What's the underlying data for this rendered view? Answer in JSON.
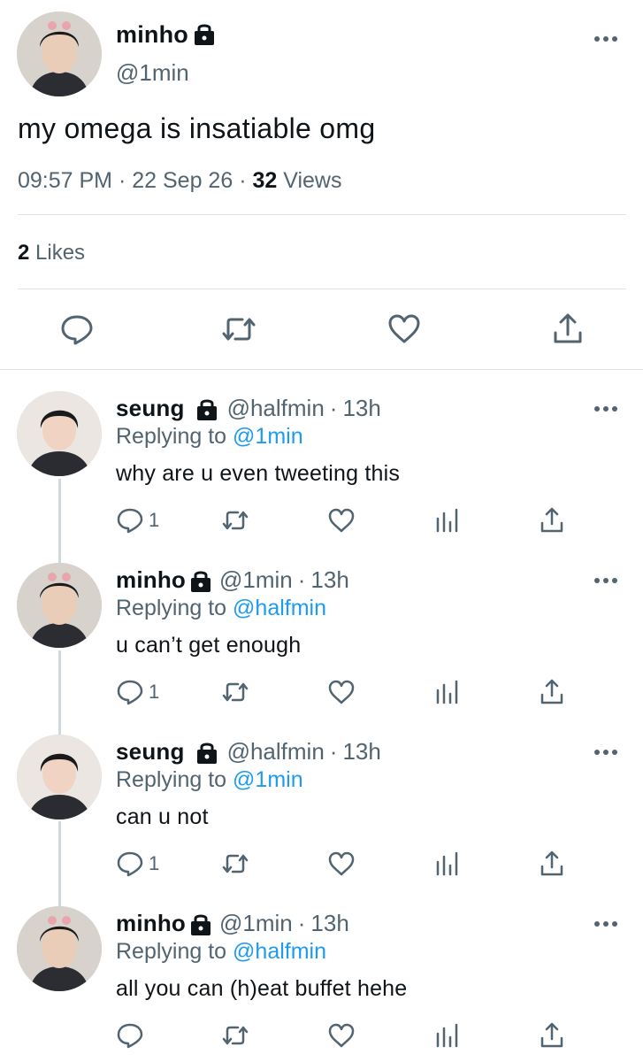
{
  "main_tweet": {
    "author_name": "minho",
    "author_handle": "@1min",
    "text": "my omega is insatiable omg",
    "time": "09:57 PM",
    "date": "22 Sep 26",
    "views_count": "32",
    "views_label": "Views",
    "likes_count": "2",
    "likes_label": "Likes",
    "actions": [
      "reply-icon",
      "retweet-icon",
      "like-icon",
      "share-icon"
    ]
  },
  "replies": [
    {
      "author_name": "seung",
      "author_handle": "@halfmin",
      "time": "13h",
      "replying_label": "Replying to",
      "replying_to": "@1min",
      "text": "why are u even tweeting this",
      "reply_count": "1"
    },
    {
      "author_name": "minho",
      "author_handle": "@1min",
      "time": "13h",
      "replying_label": "Replying to",
      "replying_to": "@halfmin",
      "text": "u can’t get enough",
      "reply_count": "1"
    },
    {
      "author_name": "seung",
      "author_handle": "@halfmin",
      "time": "13h",
      "replying_label": "Replying to",
      "replying_to": "@1min",
      "text": "can u not",
      "reply_count": "1"
    },
    {
      "author_name": "minho",
      "author_handle": "@1min",
      "time": "13h",
      "replying_label": "Replying to",
      "replying_to": "@halfmin",
      "text": "all you can (h)eat buffet hehe",
      "reply_count": ""
    }
  ],
  "colors": {
    "text": "#0f1419",
    "secondary": "#536471",
    "link": "#1d9bf0",
    "divider": "#dfe3e6",
    "thread_line": "#cfd9de"
  },
  "separator": "·"
}
